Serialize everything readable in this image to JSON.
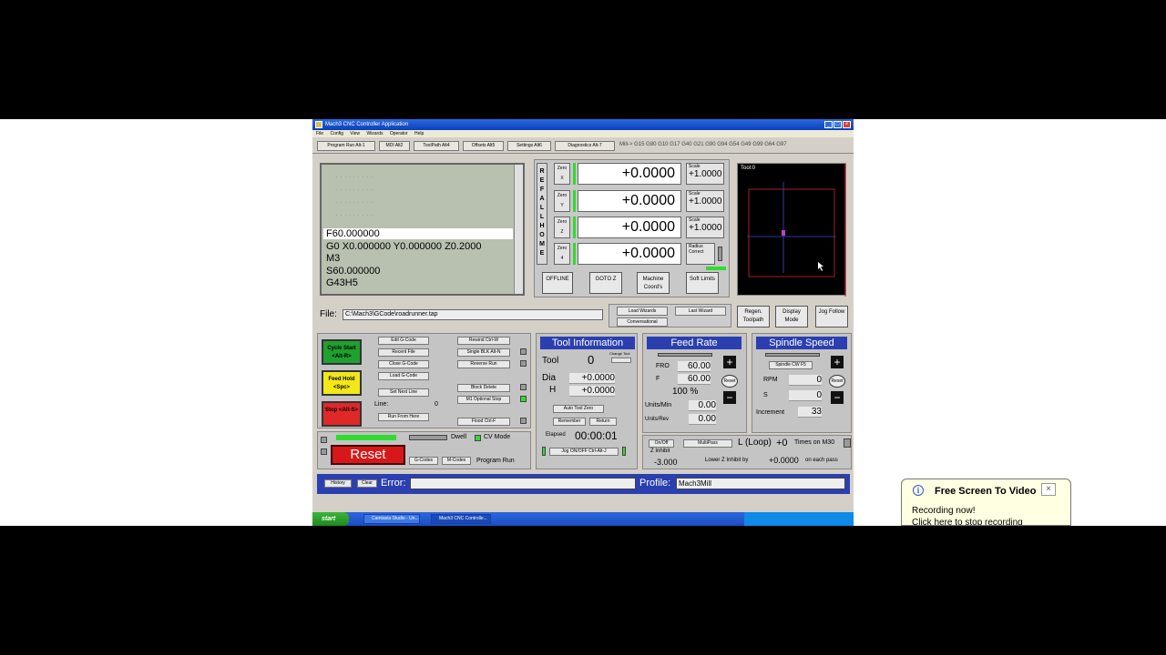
{
  "window": {
    "title": "Mach3 CNC Controller Application",
    "menu": [
      "File",
      "Config",
      "View",
      "Wizards",
      "Operator",
      "Help"
    ]
  },
  "tabs": [
    "Program Run Alt-1",
    "MDI Alt2",
    "ToolPath Alt4",
    "Offsets Alt5",
    "Settings Alt6",
    "Diagnostics Alt-7"
  ],
  "modal_status": "Mill-> G15  G80 G10 G17 G40 G21 G90 G94 G54 G49 G99 G64 G97",
  "gcode": {
    "lines": [
      "F60.000000",
      "G0 X0.000000 Y0.000000 Z0.2000",
      "M3",
      "S60.000000",
      "G43H5"
    ]
  },
  "dro": {
    "ref_all_home": "REF ALL HOME",
    "axes": [
      {
        "zero": "Zero",
        "axis": "X",
        "value": "+0.0000",
        "scale_label": "Scale",
        "scale": "+1.0000"
      },
      {
        "zero": "Zero",
        "axis": "Y",
        "value": "+0.0000",
        "scale_label": "Scale",
        "scale": "+1.0000"
      },
      {
        "zero": "Zero",
        "axis": "Z",
        "value": "+0.0000",
        "scale_label": "Scale",
        "scale": "+1.0000"
      },
      {
        "zero": "Zero",
        "axis": "4",
        "value": "+0.0000",
        "scale_label": "Radius",
        "scale": "Correct"
      }
    ],
    "buttons": [
      "OFFLINE",
      "GOTO Z",
      "Machine Coord's",
      "Soft Limits"
    ]
  },
  "toolpath": {
    "label": "Tool:0",
    "buttons": [
      "Regen. Toolpath",
      "Display Mode",
      "Jog Follow"
    ]
  },
  "file": {
    "label": "File:",
    "path": "C:\\Mach3\\GCode\\roadrunner.tap"
  },
  "wizards": {
    "load": "Load Wizards",
    "last": "Last Wizard",
    "conversational": "Conversational"
  },
  "controls": {
    "cycle_start": "Cycle Start <Alt-R>",
    "feed_hold": "Feed Hold <Spc>",
    "stop": "Stop <Alt-S>",
    "col1": [
      "Edit G-Code",
      "Recent File",
      "Close G-Code",
      "Load G-Code",
      "Set Next Line"
    ],
    "line_label": "Line:",
    "line_value": "0",
    "run_from_here": "Run From Here",
    "col2": [
      "Rewind Ctrl-W",
      "Single BLK Alt-N",
      "Reverse Run",
      "Block Delete",
      "M1 Optional Stop",
      "Flood Ctrl-F"
    ]
  },
  "reset": {
    "label": "Reset",
    "dwell": "Dwell",
    "cv_mode": "CV Mode",
    "gcodes": "G-Codes",
    "mcodes": "M-Codes",
    "program_run": "Program Run"
  },
  "tool_info": {
    "title": "Tool Information",
    "tool_label": "Tool",
    "tool_value": "0",
    "change_tool": "Change Tool",
    "dia_label": "Dia",
    "dia_value": "+0.0000",
    "h_label": "H",
    "h_value": "+0.0000",
    "auto_tool_zero": "Auto Tool Zero",
    "remember": "Remember",
    "return": "Return",
    "elapsed_label": "Elapsed",
    "elapsed_value": "00:00:01",
    "jog": "Jog ON/OFF Ctrl-Alt-J"
  },
  "feed_rate": {
    "title": "Feed Rate",
    "fro_label": "FRO",
    "fro_value": "60.00",
    "f_label": "F",
    "f_value": "60.00",
    "percent": "100 %",
    "units_min_label": "Units/Min",
    "units_min_value": "0.00",
    "units_rev_label": "Units/Rev",
    "units_rev_value": "0.00",
    "reset": "Reset"
  },
  "spindle": {
    "title": "Spindle Speed",
    "spindle_cw": "Spindle CW F5",
    "rpm_label": "RPM",
    "rpm_value": "0",
    "s_label": "S",
    "s_value": "0",
    "increment_label": "Increment",
    "increment_value": "33",
    "reset": "Reset"
  },
  "loop": {
    "on_off": "On/Off",
    "z_inhibit": "Z Inhibit",
    "z_value": "-3.000",
    "multipass": "MultiPass",
    "loop_label": "L (Loop)",
    "loop_value": "+0",
    "times": "Times on M30",
    "lower_label": "Lower Z Inhibit by",
    "lower_value": "+0.0000",
    "each_pass": "on each pass"
  },
  "status": {
    "history": "History",
    "clear": "Clear",
    "error_label": "Error:",
    "profile_label": "Profile:",
    "profile_value": "Mach3Mill"
  },
  "taskbar": {
    "start": "start",
    "items": [
      "Camtasia Studio - Un...",
      "Mach3 CNC Controlle..."
    ]
  },
  "notification": {
    "title": "Free Screen To Video",
    "line1": "Recording now!",
    "line2": "Click here to stop recording"
  },
  "colors": {
    "panel_blue": "#2b3fb0",
    "led_green": "#2fdc2f",
    "reset_red": "#d81818",
    "cycle_green": "#1fa02f",
    "hold_yellow": "#f2e818",
    "stop_red": "#e02828"
  }
}
